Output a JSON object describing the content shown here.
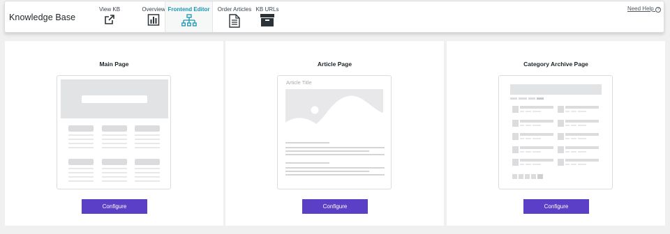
{
  "header": {
    "title": "Knowledge Base",
    "help_link": "Need Help",
    "help_icon": "?",
    "tabs": [
      {
        "label": "View KB",
        "icon": "external-link-icon",
        "active": false
      },
      {
        "label": "Overview",
        "icon": "bar-chart-icon",
        "active": false
      },
      {
        "label": "Frontend Editor",
        "icon": "sitemap-icon",
        "active": true
      },
      {
        "label": "Order Articles",
        "icon": "document-icon",
        "active": false
      },
      {
        "label": "KB URLs",
        "icon": "archive-box-icon",
        "active": false
      }
    ]
  },
  "cards": [
    {
      "title": "Main Page",
      "button": "Configure"
    },
    {
      "title": "Article Page",
      "button": "Configure",
      "preview_title": "Article Title"
    },
    {
      "title": "Category Archive Page",
      "button": "Configure"
    }
  ],
  "colors": {
    "accent": "#1a95b0",
    "button": "#5b3fc6",
    "placeholder": "#dcdcde"
  }
}
